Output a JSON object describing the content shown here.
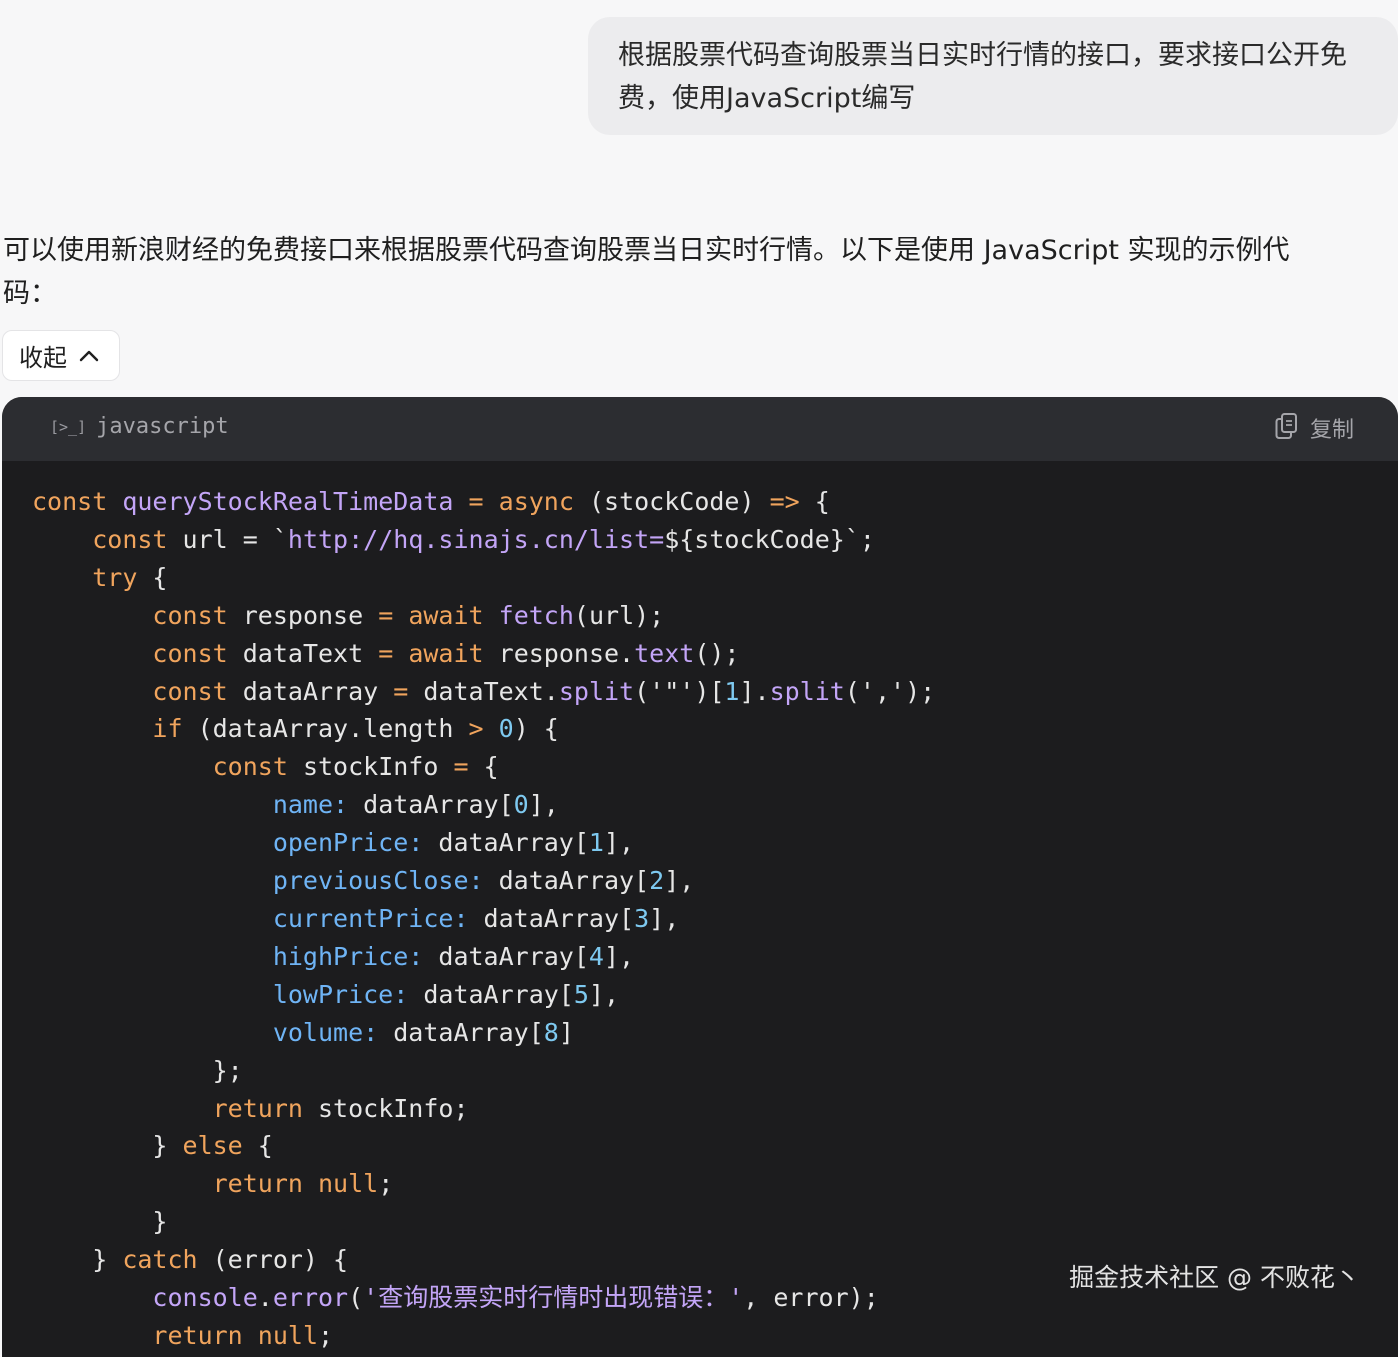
{
  "user_message": {
    "line1": "根据股票代码查询股票当日实时行情的接口，要求接口公开免",
    "line2": "费，使用JavaScript编写"
  },
  "assistant": {
    "intro_line1": "可以使用新浪财经的免费接口来根据股票代码查询股票当日实时行情。以下是使用 JavaScript 实现的示例代",
    "intro_line2": "码："
  },
  "collapse_button": {
    "label": "收起",
    "icon": "chevron-up-icon"
  },
  "code_block": {
    "language_icon": "[>_]",
    "language": "javascript",
    "copy_label": "复制",
    "copy_icon": "copy-icon",
    "lines": [
      [
        [
          "kw",
          "const"
        ],
        [
          "t",
          " "
        ],
        [
          "fn",
          "queryStockRealTimeData"
        ],
        [
          "t",
          " "
        ],
        [
          "kw",
          "="
        ],
        [
          "t",
          " "
        ],
        [
          "kw",
          "async"
        ],
        [
          "t",
          " (stockCode) "
        ],
        [
          "kw",
          "=>"
        ],
        [
          "t",
          " {"
        ]
      ],
      [
        [
          "t",
          "    "
        ],
        [
          "kw",
          "const"
        ],
        [
          "t",
          " url = `"
        ],
        [
          "str",
          "http://hq.sinajs.cn/list="
        ],
        [
          "t",
          "${stockCode}`;"
        ]
      ],
      [
        [
          "t",
          "    "
        ],
        [
          "kw",
          "try"
        ],
        [
          "t",
          " {"
        ]
      ],
      [
        [
          "t",
          "        "
        ],
        [
          "kw",
          "const"
        ],
        [
          "t",
          " response "
        ],
        [
          "kw",
          "="
        ],
        [
          "t",
          " "
        ],
        [
          "kw",
          "await"
        ],
        [
          "t",
          " "
        ],
        [
          "fn",
          "fetch"
        ],
        [
          "t",
          "(url);"
        ]
      ],
      [
        [
          "t",
          "        "
        ],
        [
          "kw",
          "const"
        ],
        [
          "t",
          " dataText "
        ],
        [
          "kw",
          "="
        ],
        [
          "t",
          " "
        ],
        [
          "kw",
          "await"
        ],
        [
          "t",
          " response."
        ],
        [
          "fn",
          "text"
        ],
        [
          "t",
          "();"
        ]
      ],
      [
        [
          "t",
          "        "
        ],
        [
          "kw",
          "const"
        ],
        [
          "t",
          " dataArray "
        ],
        [
          "kw",
          "="
        ],
        [
          "t",
          " dataText."
        ],
        [
          "fn",
          "split"
        ],
        [
          "t",
          "('\"')["
        ],
        [
          "num",
          "1"
        ],
        [
          "t",
          "]."
        ],
        [
          "fn",
          "split"
        ],
        [
          "t",
          "(',');"
        ]
      ],
      [
        [
          "t",
          "        "
        ],
        [
          "kw",
          "if"
        ],
        [
          "t",
          " (dataArray.length "
        ],
        [
          "kw",
          ">"
        ],
        [
          "t",
          " "
        ],
        [
          "num",
          "0"
        ],
        [
          "t",
          ") {"
        ]
      ],
      [
        [
          "t",
          "            "
        ],
        [
          "kw",
          "const"
        ],
        [
          "t",
          " stockInfo "
        ],
        [
          "kw",
          "="
        ],
        [
          "t",
          " {"
        ]
      ],
      [
        [
          "t",
          "                "
        ],
        [
          "prop",
          "name:"
        ],
        [
          "t",
          " dataArray["
        ],
        [
          "num",
          "0"
        ],
        [
          "t",
          "],"
        ]
      ],
      [
        [
          "t",
          "                "
        ],
        [
          "prop",
          "openPrice:"
        ],
        [
          "t",
          " dataArray["
        ],
        [
          "num",
          "1"
        ],
        [
          "t",
          "],"
        ]
      ],
      [
        [
          "t",
          "                "
        ],
        [
          "prop",
          "previousClose:"
        ],
        [
          "t",
          " dataArray["
        ],
        [
          "num",
          "2"
        ],
        [
          "t",
          "],"
        ]
      ],
      [
        [
          "t",
          "                "
        ],
        [
          "prop",
          "currentPrice:"
        ],
        [
          "t",
          " dataArray["
        ],
        [
          "num",
          "3"
        ],
        [
          "t",
          "],"
        ]
      ],
      [
        [
          "t",
          "                "
        ],
        [
          "prop",
          "highPrice:"
        ],
        [
          "t",
          " dataArray["
        ],
        [
          "num",
          "4"
        ],
        [
          "t",
          "],"
        ]
      ],
      [
        [
          "t",
          "                "
        ],
        [
          "prop",
          "lowPrice:"
        ],
        [
          "t",
          " dataArray["
        ],
        [
          "num",
          "5"
        ],
        [
          "t",
          "],"
        ]
      ],
      [
        [
          "t",
          "                "
        ],
        [
          "prop",
          "volume:"
        ],
        [
          "t",
          " dataArray["
        ],
        [
          "num",
          "8"
        ],
        [
          "t",
          "]"
        ]
      ],
      [
        [
          "t",
          "            };"
        ]
      ],
      [
        [
          "t",
          "            "
        ],
        [
          "kw",
          "return"
        ],
        [
          "t",
          " stockInfo;"
        ]
      ],
      [
        [
          "t",
          "        } "
        ],
        [
          "kw",
          "else"
        ],
        [
          "t",
          " {"
        ]
      ],
      [
        [
          "t",
          "            "
        ],
        [
          "kw",
          "return"
        ],
        [
          "t",
          " "
        ],
        [
          "kw",
          "null"
        ],
        [
          "t",
          ";"
        ]
      ],
      [
        [
          "t",
          "        }"
        ]
      ],
      [
        [
          "t",
          "    } "
        ],
        [
          "kw",
          "catch"
        ],
        [
          "t",
          " (error) {"
        ]
      ],
      [
        [
          "t",
          "        "
        ],
        [
          "fn",
          "console"
        ],
        [
          "t",
          "."
        ],
        [
          "fn",
          "error"
        ],
        [
          "t",
          "("
        ],
        [
          "str",
          "'查询股票实时行情时出现错误：'"
        ],
        [
          "t",
          ", error);"
        ]
      ],
      [
        [
          "t",
          "        "
        ],
        [
          "kw",
          "return"
        ],
        [
          "t",
          " "
        ],
        [
          "kw",
          "null"
        ],
        [
          "t",
          ";"
        ]
      ]
    ]
  },
  "watermark": "掘金技术社区 @ 不败花丶"
}
